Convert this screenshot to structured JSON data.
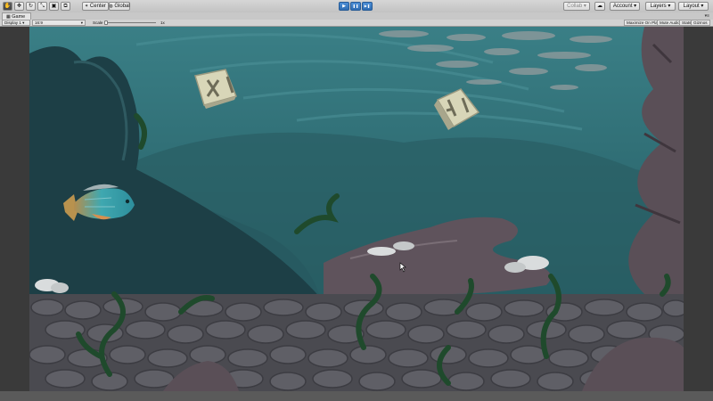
{
  "toolbar": {
    "tools": [
      {
        "name": "hand-tool-icon",
        "glyph": "✋"
      },
      {
        "name": "move-tool-icon",
        "glyph": "✥"
      },
      {
        "name": "rotate-tool-icon",
        "glyph": "↻"
      },
      {
        "name": "scale-tool-icon",
        "glyph": "⤡"
      },
      {
        "name": "rect-tool-icon",
        "glyph": "▣"
      },
      {
        "name": "transform-tool-icon",
        "glyph": "⧉"
      }
    ],
    "pivot_label": "Center",
    "space_label": "Global",
    "play_glyph": "▶",
    "pause_glyph": "❚❚",
    "step_glyph": "▶❚",
    "collab_label": "Collab ▾",
    "cloud_glyph": "☁",
    "account_label": "Account",
    "layers_label": "Layers",
    "layout_label": "Layout"
  },
  "tab": {
    "label": "Game",
    "icon": "game-icon"
  },
  "gamebar": {
    "display": "Display 1",
    "aspect": "16:9",
    "scale_label": "Scale",
    "scale_value": "1x",
    "maximize": "Maximize On Play",
    "mute": "Mute Audio",
    "stats": "Stats",
    "gizmos": "Gizmos"
  },
  "colors": {
    "water_top": "#3a7f86",
    "water_bottom": "#1f4f55",
    "rock": "#5a4f57",
    "crate": "#d8d6b8",
    "fish": "#3fa8b0"
  }
}
